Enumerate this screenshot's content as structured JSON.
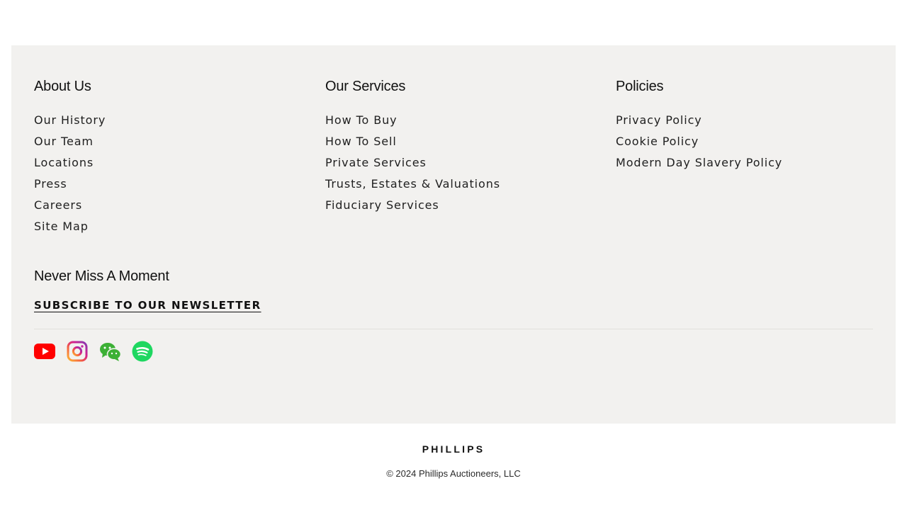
{
  "about": {
    "heading": "About Us",
    "links": [
      "Our History",
      "Our Team",
      "Locations",
      "Press",
      "Careers",
      "Site Map"
    ]
  },
  "services": {
    "heading": "Our Services",
    "links": [
      "How To Buy",
      "How To Sell",
      "Private Services",
      "Trusts, Estates & Valuations",
      "Fiduciary Services"
    ]
  },
  "policies": {
    "heading": "Policies",
    "links": [
      "Privacy Policy",
      "Cookie Policy",
      "Modern Day Slavery Policy"
    ]
  },
  "newsletter": {
    "heading": "Never Miss A Moment",
    "cta": "SUBSCRIBE TO OUR NEWSLETTER"
  },
  "social": {
    "icons": [
      "youtube-icon",
      "instagram-icon",
      "wechat-icon",
      "spotify-icon"
    ],
    "colors": {
      "youtube": "#ff0000",
      "wechat": "#3cb035",
      "spotify": "#1ed760"
    }
  },
  "brand": {
    "logo_text": "PHILLIPS",
    "copyright": "© 2024 Phillips Auctioneers, LLC"
  },
  "colors": {
    "panel_bg": "#f2f1ef",
    "page_bg": "#ffffff"
  }
}
